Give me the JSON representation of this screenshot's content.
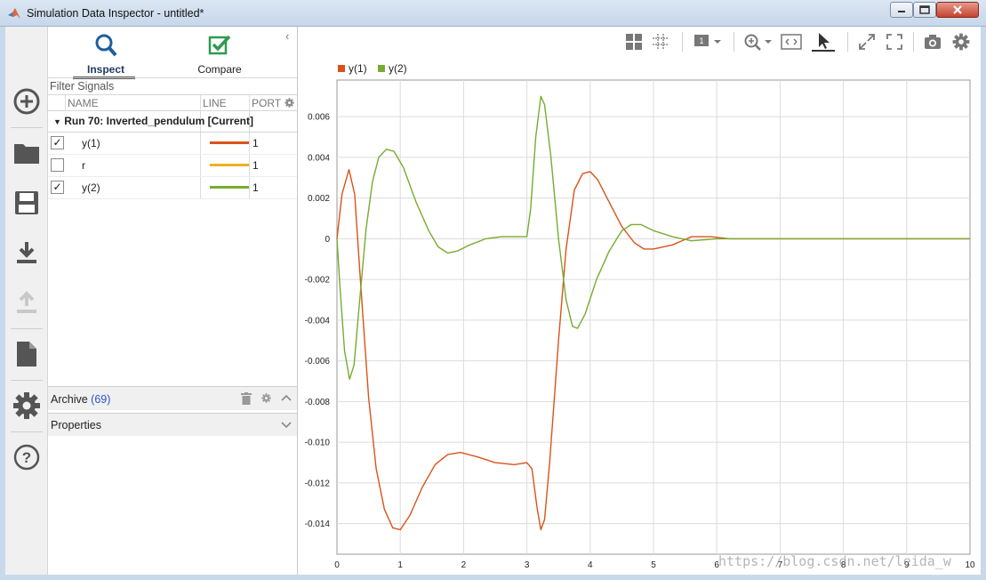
{
  "window": {
    "title": "Simulation Data Inspector - untitled*",
    "icon": "matlab-logo-icon",
    "controls": [
      "minimize-icon",
      "maximize-icon",
      "close-icon"
    ]
  },
  "sidebar": {
    "buttons": [
      "add-icon",
      "folder-open-icon",
      "save-icon",
      "download-icon",
      "upload-icon",
      "document-icon",
      "gear-icon",
      "help-icon"
    ]
  },
  "tabs": [
    {
      "label": "Inspect",
      "icon": "magnifier-icon",
      "active": true
    },
    {
      "label": "Compare",
      "icon": "checkmark-icon",
      "active": false
    }
  ],
  "filter": {
    "placeholder": "Filter Signals"
  },
  "columns": {
    "name": "NAME",
    "line": "LINE",
    "port": "PORT"
  },
  "run": {
    "label": "Run 70: Inverted_pendulum [Current]"
  },
  "signals": [
    {
      "name": "y(1)",
      "checked": true,
      "color": "#d95319",
      "port": "1"
    },
    {
      "name": "r",
      "checked": false,
      "color": "#edb120",
      "port": "1"
    },
    {
      "name": "y(2)",
      "checked": true,
      "color": "#77ac30",
      "port": "1"
    }
  ],
  "check_glyph": "✓",
  "archive": {
    "label": "Archive",
    "count": "(69)"
  },
  "properties": {
    "label": "Properties"
  },
  "watermark": "https://blog.csdn.net/leida_w",
  "chart_data": {
    "type": "line",
    "xlim": [
      0,
      10
    ],
    "ylim": [
      -0.0155,
      0.0078
    ],
    "x_ticks": [
      "0",
      "1",
      "2",
      "3",
      "4",
      "5",
      "6",
      "7",
      "8",
      "9",
      "10"
    ],
    "y_ticks": [
      "0.006",
      "0.004",
      "0.002",
      "0",
      "-0.002",
      "-0.004",
      "-0.006",
      "-0.008",
      "-0.010",
      "-0.012",
      "-0.014"
    ],
    "grid": true,
    "legend_position": "top-left",
    "series": [
      {
        "name": "y(1)",
        "color": "#d95319",
        "points": [
          [
            0,
            0
          ],
          [
            0.08,
            0.0022
          ],
          [
            0.19,
            0.0034
          ],
          [
            0.28,
            0.0022
          ],
          [
            0.38,
            -0.0025
          ],
          [
            0.5,
            -0.0078
          ],
          [
            0.62,
            -0.0113
          ],
          [
            0.75,
            -0.0133
          ],
          [
            0.88,
            -0.0142
          ],
          [
            1.0,
            -0.0143
          ],
          [
            1.15,
            -0.0136
          ],
          [
            1.35,
            -0.0122
          ],
          [
            1.55,
            -0.0111
          ],
          [
            1.75,
            -0.0106
          ],
          [
            1.95,
            -0.0105
          ],
          [
            2.2,
            -0.0107
          ],
          [
            2.5,
            -0.011
          ],
          [
            2.8,
            -0.0111
          ],
          [
            3.0,
            -0.011
          ],
          [
            3.08,
            -0.0113
          ],
          [
            3.16,
            -0.0132
          ],
          [
            3.22,
            -0.0143
          ],
          [
            3.28,
            -0.0138
          ],
          [
            3.36,
            -0.011
          ],
          [
            3.5,
            -0.005
          ],
          [
            3.62,
            -0.0005
          ],
          [
            3.75,
            0.0024
          ],
          [
            3.88,
            0.0032
          ],
          [
            4.0,
            0.0033
          ],
          [
            4.12,
            0.0029
          ],
          [
            4.3,
            0.0018
          ],
          [
            4.5,
            0.0006
          ],
          [
            4.7,
            -0.0002
          ],
          [
            4.85,
            -0.0005
          ],
          [
            5.0,
            -0.0005
          ],
          [
            5.3,
            -0.0003
          ],
          [
            5.6,
            0.0001
          ],
          [
            5.9,
            0.0001
          ],
          [
            6.2,
            0.0
          ],
          [
            7.0,
            0.0
          ],
          [
            10.0,
            0.0
          ]
        ]
      },
      {
        "name": "y(2)",
        "color": "#77ac30",
        "points": [
          [
            0,
            0
          ],
          [
            0.05,
            -0.0025
          ],
          [
            0.12,
            -0.0055
          ],
          [
            0.2,
            -0.0069
          ],
          [
            0.27,
            -0.0062
          ],
          [
            0.36,
            -0.003
          ],
          [
            0.46,
            0.0005
          ],
          [
            0.56,
            0.0028
          ],
          [
            0.66,
            0.004
          ],
          [
            0.78,
            0.0044
          ],
          [
            0.9,
            0.0043
          ],
          [
            1.05,
            0.0035
          ],
          [
            1.25,
            0.0018
          ],
          [
            1.45,
            0.0004
          ],
          [
            1.6,
            -0.0004
          ],
          [
            1.75,
            -0.0007
          ],
          [
            1.9,
            -0.0006
          ],
          [
            2.1,
            -0.0003
          ],
          [
            2.35,
            0.0
          ],
          [
            2.6,
            0.0001
          ],
          [
            2.9,
            0.0001
          ],
          [
            3.0,
            0.0001
          ],
          [
            3.06,
            0.0015
          ],
          [
            3.14,
            0.005
          ],
          [
            3.22,
            0.007
          ],
          [
            3.28,
            0.0066
          ],
          [
            3.38,
            0.004
          ],
          [
            3.5,
            0.0
          ],
          [
            3.62,
            -0.003
          ],
          [
            3.72,
            -0.0043
          ],
          [
            3.8,
            -0.0044
          ],
          [
            3.92,
            -0.0037
          ],
          [
            4.1,
            -0.002
          ],
          [
            4.3,
            -0.0006
          ],
          [
            4.5,
            0.0004
          ],
          [
            4.65,
            0.0007
          ],
          [
            4.8,
            0.0007
          ],
          [
            5.0,
            0.0004
          ],
          [
            5.3,
            0.0001
          ],
          [
            5.6,
            -0.0001
          ],
          [
            6.0,
            0.0
          ],
          [
            7.0,
            0.0
          ],
          [
            10.0,
            0.0
          ]
        ]
      }
    ]
  }
}
